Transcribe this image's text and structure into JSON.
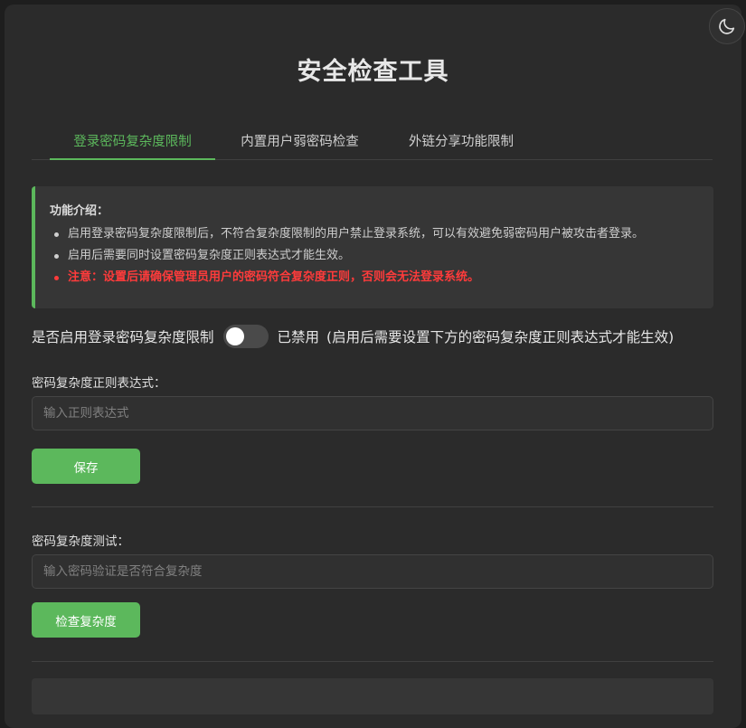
{
  "page": {
    "title": "安全检查工具"
  },
  "tabs": [
    {
      "label": "登录密码复杂度限制"
    },
    {
      "label": "内置用户弱密码检查"
    },
    {
      "label": "外链分享功能限制"
    }
  ],
  "info": {
    "title": "功能介绍：",
    "items": [
      "启用登录密码复杂度限制后，不符合复杂度限制的用户禁止登录系统，可以有效避免弱密码用户被攻击者登录。",
      "启用后需要同时设置密码复杂度正则表达式才能生效。",
      "注意：设置后请确保管理员用户的密码符合复杂度正则，否则会无法登录系统。"
    ]
  },
  "switch": {
    "label": "是否启用登录密码复杂度限制",
    "status": "已禁用",
    "note": "(启用后需要设置下方的密码复杂度正则表达式才能生效)",
    "enabled": false
  },
  "regex": {
    "label": "密码复杂度正则表达式：",
    "placeholder": "输入正则表达式",
    "value": ""
  },
  "save_button": {
    "label": "保存"
  },
  "test": {
    "label": "密码复杂度测试：",
    "placeholder": "输入密码验证是否符合复杂度",
    "value": ""
  },
  "check_button": {
    "label": "检查复杂度"
  },
  "colors": {
    "accent": "#5cb85c",
    "warning": "#ff3b3b",
    "background": "#2b2b2b"
  },
  "icons": {
    "theme_toggle": "moon-icon"
  }
}
